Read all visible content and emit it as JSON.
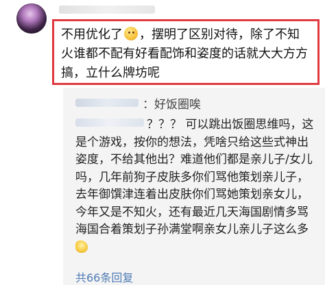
{
  "comment": {
    "text_part1": "不用优化了",
    "text_part2": "，摆明了区别对待，除了不知火谁都不配有好看配饰和姿度的话就大大方方搞，立什么牌坊呢",
    "emoji_icon": "grimace-emoji"
  },
  "reply": {
    "head_label": "：好饭圈唉",
    "body_text": "？？？ 可以跳出饭圈思维吗，这是个游戏，按你的想法，凭啥只给这些式神出姿度，不给其他出？难道他们都是亲儿子/女儿吗，几年前狗子皮肤多你们骂他策划亲儿子，去年御馔津连着出皮肤你们骂她策划亲女儿，今年又是不知火，还有最近几天海国剧情多骂海国合着策划子孙满堂啊亲女儿亲儿子这么多",
    "emoji_icon": "laugh-emoji",
    "count_label": "共66条回复"
  },
  "colors": {
    "highlight_border": "#e0383e",
    "link": "#4e7bb5",
    "panel_bg": "#f4f4f4"
  }
}
